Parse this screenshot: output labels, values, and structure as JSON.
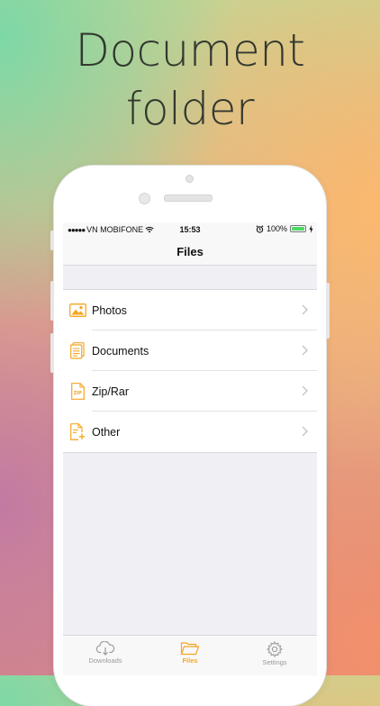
{
  "headline": {
    "line1": "Document",
    "line2": "folder"
  },
  "status_bar": {
    "signal_dots": "●●●●●",
    "carrier": "VN MOBIFONE",
    "time": "15:53",
    "battery_percent": "100%",
    "battery_level": 1.0
  },
  "nav": {
    "title": "Files"
  },
  "files": [
    {
      "label": "Photos",
      "icon": "photo-icon"
    },
    {
      "label": "Documents",
      "icon": "document-icon"
    },
    {
      "label": "Zip/Rar",
      "icon": "zip-icon"
    },
    {
      "label": "Other",
      "icon": "other-file-icon"
    }
  ],
  "tabs": [
    {
      "label": "Downloads",
      "icon": "cloud-download-icon",
      "active": false
    },
    {
      "label": "Files",
      "icon": "folder-icon",
      "active": true
    },
    {
      "label": "Settings",
      "icon": "gear-icon",
      "active": false
    }
  ],
  "colors": {
    "accent": "#f5a623",
    "inactive": "#9a9a9a",
    "battery": "#4cd964"
  }
}
